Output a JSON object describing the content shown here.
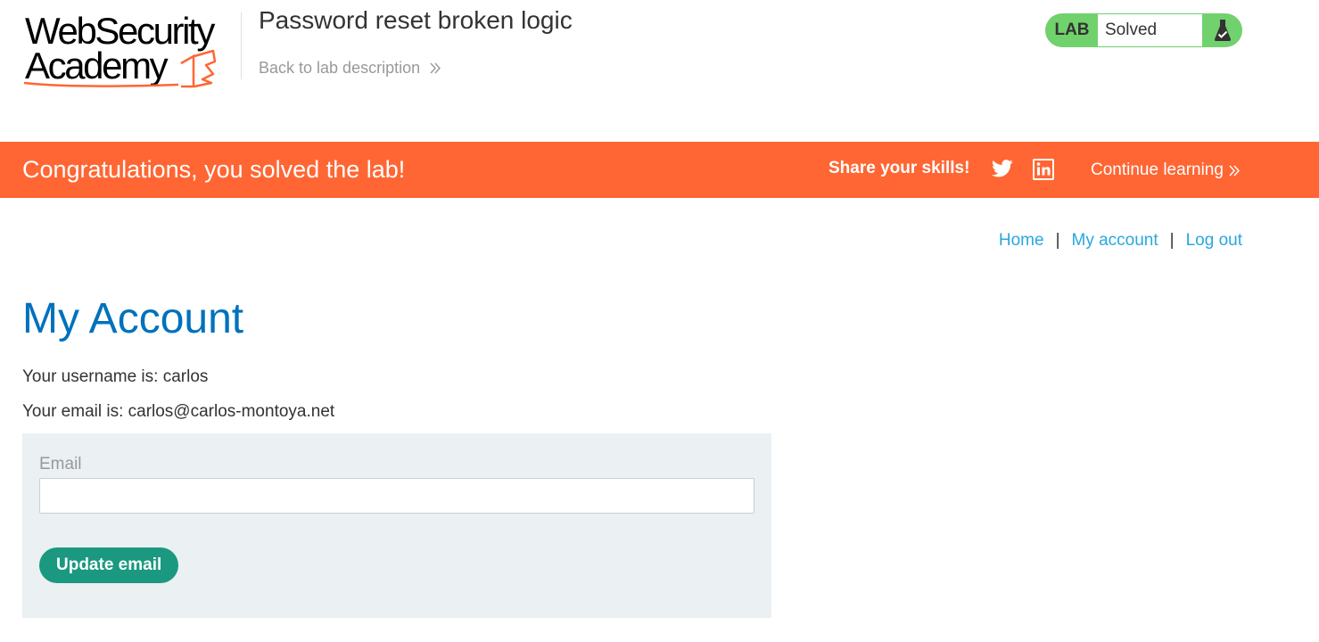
{
  "header": {
    "logo_line1": "WebSecurity",
    "logo_line2": "Academy",
    "lab_title": "Password reset broken logic",
    "back_link_label": "Back to lab description"
  },
  "lab_status": {
    "label": "LAB",
    "state": "Solved",
    "icon": "flask-check-icon",
    "color": "#70d16d"
  },
  "banner": {
    "message": "Congratulations, you solved the lab!",
    "share_label": "Share your skills!",
    "continue_label": "Continue learning",
    "icons": [
      "twitter-icon",
      "linkedin-icon",
      "double-chevron-right-icon"
    ],
    "color": "#ff6633"
  },
  "nav": {
    "home": "Home",
    "separator": "|",
    "my_account": "My account",
    "log_out": "Log out"
  },
  "main": {
    "heading": "My Account",
    "username_line": "Your username is: carlos",
    "email_line": "Your email is: carlos@carlos-montoya.net",
    "form": {
      "email_label": "Email",
      "email_value": "",
      "submit_label": "Update email"
    }
  },
  "colors": {
    "heading_blue": "#0071bc",
    "link_blue": "#29a7df",
    "button_green": "#1a9980",
    "form_bg": "#ebf0f2"
  }
}
